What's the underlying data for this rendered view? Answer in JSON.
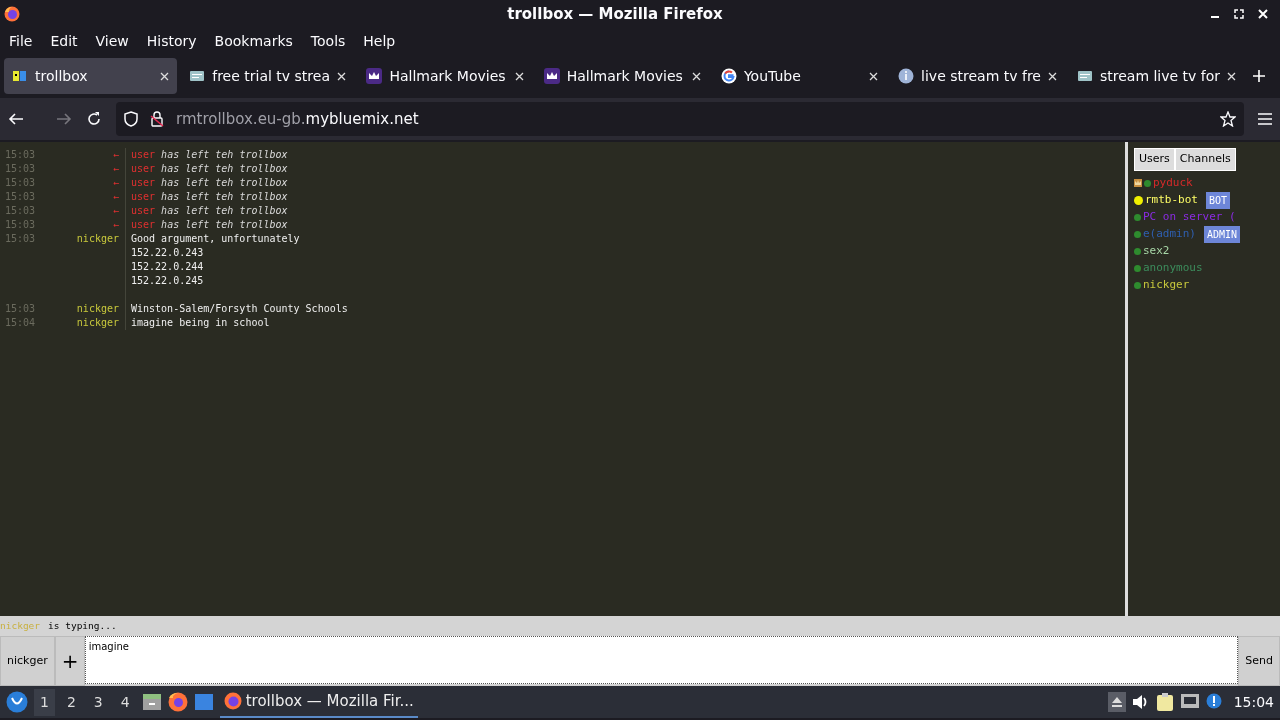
{
  "window": {
    "title": "trollbox — Mozilla Firefox"
  },
  "menu": [
    "File",
    "Edit",
    "View",
    "History",
    "Bookmarks",
    "Tools",
    "Help"
  ],
  "tabs": [
    {
      "label": "trollbox",
      "selected": true,
      "kind": "trollbox"
    },
    {
      "label": "free trial tv strea",
      "selected": false,
      "kind": "page"
    },
    {
      "label": "Hallmark Movies",
      "selected": false,
      "kind": "crown"
    },
    {
      "label": "Hallmark Movies",
      "selected": false,
      "kind": "crown"
    },
    {
      "label": "YouTube",
      "selected": false,
      "kind": "google"
    },
    {
      "label": "live stream tv fre",
      "selected": false,
      "kind": "info"
    },
    {
      "label": "stream live tv for",
      "selected": false,
      "kind": "page"
    }
  ],
  "address": {
    "prefix": "rmtrollbox.eu-gb.",
    "domain": "mybluemix.net"
  },
  "chat": [
    {
      "kind": "leave",
      "time": "15:03",
      "arrow": "←",
      "user": "user",
      "text": "has left teh trollbox"
    },
    {
      "kind": "leave",
      "time": "15:03",
      "arrow": "←",
      "user": "user",
      "text": "has left teh trollbox"
    },
    {
      "kind": "leave",
      "time": "15:03",
      "arrow": "←",
      "user": "user",
      "text": "has left teh trollbox"
    },
    {
      "kind": "leave",
      "time": "15:03",
      "arrow": "←",
      "user": "user",
      "text": "has left teh trollbox"
    },
    {
      "kind": "leave",
      "time": "15:03",
      "arrow": "←",
      "user": "user",
      "text": "has left teh trollbox"
    },
    {
      "kind": "leave",
      "time": "15:03",
      "arrow": "←",
      "user": "user",
      "text": "has left teh trollbox"
    },
    {
      "kind": "message",
      "time": "15:03",
      "nick": "nickger",
      "lines": [
        "Good argument, unfortunately",
        "152.22.0.243",
        "152.22.0.244",
        "152.22.0.245"
      ]
    },
    {
      "kind": "message",
      "time": "15:03",
      "nick": "nickger",
      "lines": [
        "Winston-Salem/Forsyth County Schools"
      ]
    },
    {
      "kind": "message",
      "time": "15:04",
      "nick": "nickger",
      "lines": [
        "imagine being in school"
      ]
    }
  ],
  "sidebar_tabs": [
    "Users",
    "Channels"
  ],
  "users": [
    {
      "name": "pyduck",
      "color": "#d42a2a",
      "kind": "owner"
    },
    {
      "name": "rmtb-bot",
      "color": "#ffff66",
      "kind": "bot",
      "badge": "BOT"
    },
    {
      "name": "PC on server (",
      "color": "#8a2be2",
      "kind": "user"
    },
    {
      "name": "e(admin)",
      "color": "#2f5fb0",
      "kind": "user",
      "badge": "ADMIN"
    },
    {
      "name": "sex2",
      "color": "#a8d8a8",
      "kind": "user"
    },
    {
      "name": "anonymous",
      "color": "#3c8c5c",
      "kind": "user"
    },
    {
      "name": "nickger",
      "color": "#c8c83c",
      "kind": "user"
    }
  ],
  "typing": {
    "nick": "nickger",
    "text": "is typing..."
  },
  "composer": {
    "nick": "nickger",
    "plus": "+",
    "value": "imagine ",
    "send": "Send"
  },
  "taskbar": {
    "workspaces": [
      {
        "label": "1",
        "selected": true
      },
      {
        "label": "2",
        "selected": false
      },
      {
        "label": "3",
        "selected": false
      },
      {
        "label": "4",
        "selected": false
      }
    ],
    "task": "trollbox — Mozilla Fir...",
    "clock": "15:04"
  }
}
